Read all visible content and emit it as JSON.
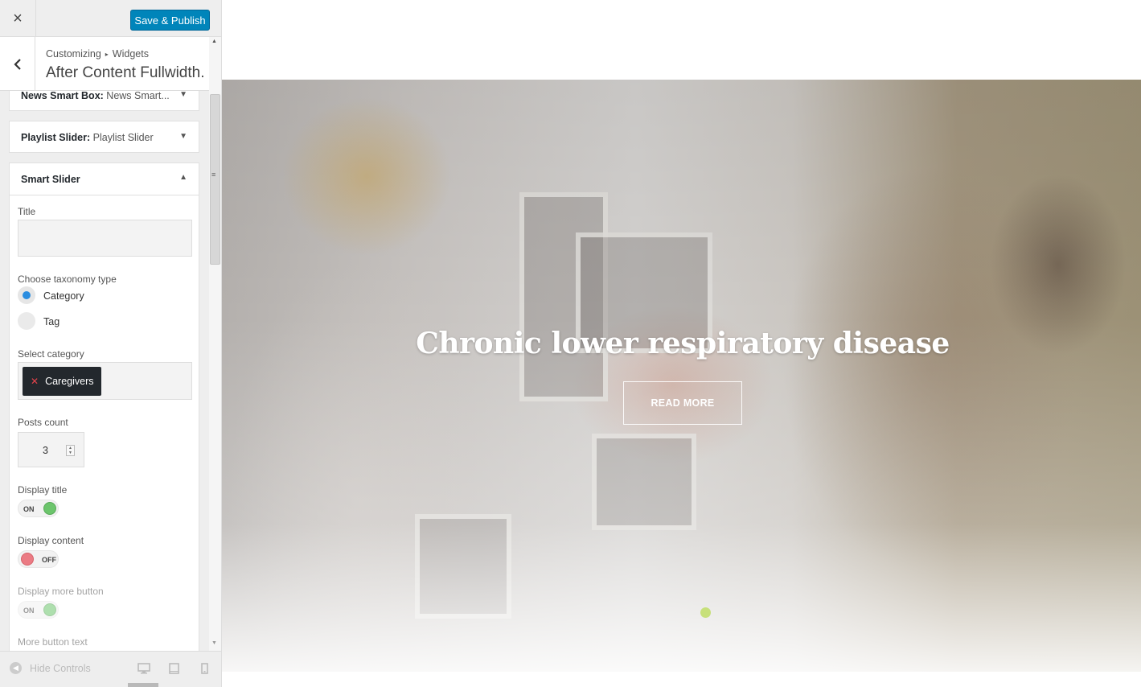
{
  "header": {
    "close_icon": "×",
    "save_label": "Save & Publish"
  },
  "panel": {
    "breadcrumb": [
      "Customizing",
      "Widgets"
    ],
    "title": "After Content Fullwidth..."
  },
  "widgets": [
    {
      "name": "News Smart Box:",
      "sub": "News Smart..."
    },
    {
      "name": "Playlist Slider:",
      "sub": "Playlist Slider"
    }
  ],
  "smart_slider": {
    "name": "Smart Slider",
    "title_label": "Title",
    "title_value": "",
    "taxonomy_label": "Choose taxonomy type",
    "taxonomy_options": [
      {
        "label": "Category",
        "selected": true
      },
      {
        "label": "Tag",
        "selected": false
      }
    ],
    "category_label": "Select category",
    "category_tags": [
      "Caregivers"
    ],
    "posts_label": "Posts count",
    "posts_value": "3",
    "display_title_label": "Display title",
    "display_title_state": "ON",
    "display_content_label": "Display content",
    "display_content_state": "OFF",
    "display_more_label": "Display more button",
    "display_more_state": "ON",
    "more_text_label": "More button text"
  },
  "footer": {
    "hide_controls": "Hide Controls",
    "devices": [
      "desktop-icon",
      "tablet-icon",
      "mobile-icon"
    ]
  },
  "preview": {
    "hero_title": "Chronic lower respiratory disease",
    "button_label": "READ MORE"
  },
  "colors": {
    "primary_button": "#0085ba",
    "toggle_on": "#6cc56c",
    "toggle_off": "#eb7b84",
    "radio_selected": "#2a8de0"
  }
}
